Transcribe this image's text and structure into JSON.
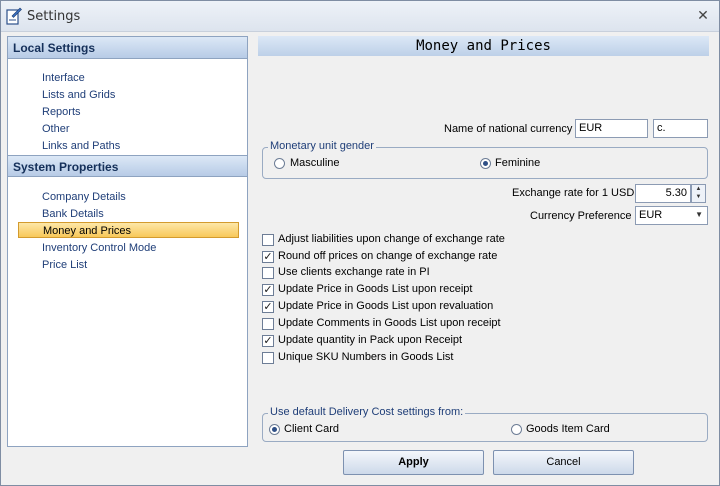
{
  "window": {
    "title": "Settings"
  },
  "sidebar": {
    "local_header": "Local Settings",
    "local_items": [
      "Interface",
      "Lists and Grids",
      "Reports",
      "Other",
      "Links and Paths"
    ],
    "system_header": "System Properties",
    "system_items": [
      "Company Details",
      "Bank Details",
      "Money and Prices",
      "Inventory Control Mode",
      "Price List"
    ],
    "selected": "Money and Prices"
  },
  "panel": {
    "title": "Money and Prices",
    "national_currency_label": "Name of national currency",
    "national_currency_value": "EUR",
    "national_currency_short": "c.",
    "gender_group_title": "Monetary unit gender",
    "gender_options": [
      "Masculine",
      "Feminine"
    ],
    "gender_selected": "Feminine",
    "exchange_rate_label": "Exchange rate for 1 USD",
    "exchange_rate_value": "5.30",
    "currency_pref_label": "Currency Preference",
    "currency_pref_value": "EUR",
    "options": [
      {
        "label": "Adjust liabilities upon change of exchange rate",
        "checked": false
      },
      {
        "label": "Round off prices on change of exchange rate",
        "checked": true
      },
      {
        "label": "Use clients exchange rate in PI",
        "checked": false
      },
      {
        "label": "Update Price in Goods List upon receipt",
        "checked": true
      },
      {
        "label": "Update Price in Goods List upon revaluation",
        "checked": true
      },
      {
        "label": "Update Comments in Goods List upon receipt",
        "checked": false
      },
      {
        "label": "Update quantity in Pack upon Receipt",
        "checked": true
      },
      {
        "label": "Unique SKU Numbers in Goods List",
        "checked": false
      }
    ],
    "delivery_group_title": "Use default Delivery Cost settings from:",
    "delivery_options": [
      "Client Card",
      "Goods Item Card"
    ],
    "delivery_selected": "Client Card"
  },
  "buttons": {
    "apply": "Apply",
    "cancel": "Cancel"
  },
  "colors": {
    "selection": "#f8c85a",
    "header": "#b7cbe6",
    "link": "#1f3e78"
  }
}
